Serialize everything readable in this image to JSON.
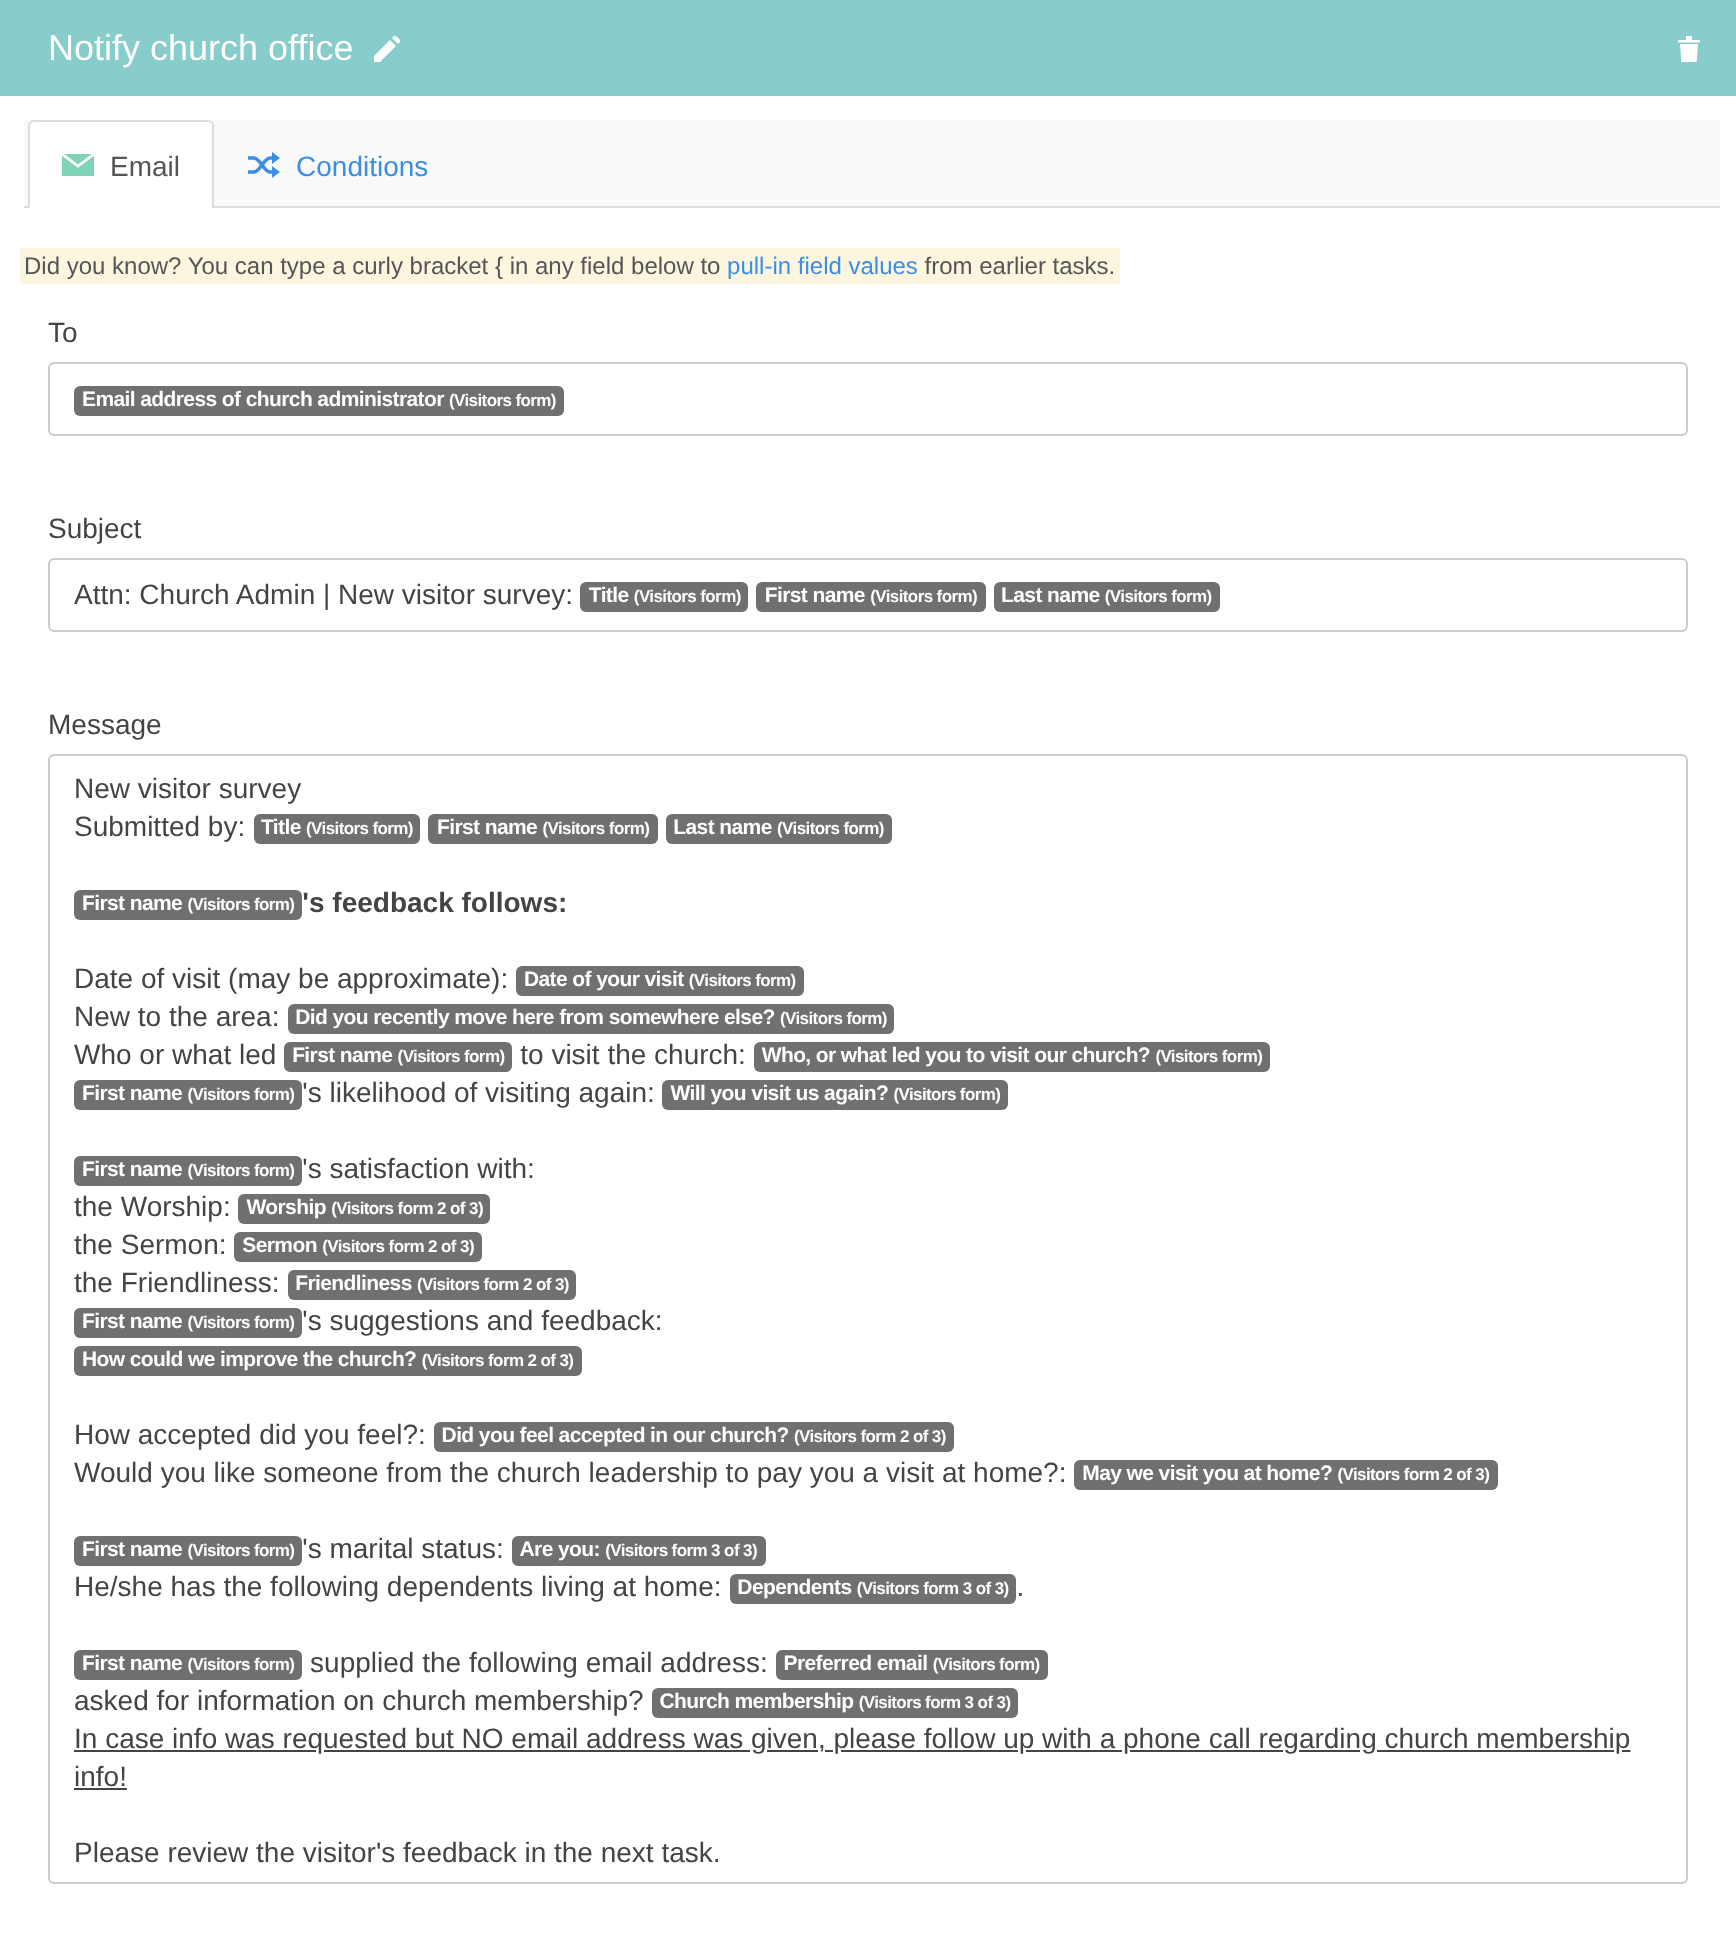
{
  "header": {
    "title": "Notify church office"
  },
  "tabs": [
    {
      "label": "Email",
      "kind": "envelope",
      "selected": true
    },
    {
      "label": "Conditions",
      "kind": "shuffle",
      "selected": false
    }
  ],
  "tip": {
    "before": "Did you know? You can type a curly bracket { in any field below to ",
    "link": "pull-in field values",
    "after": " from earlier tasks."
  },
  "to": {
    "label": "To",
    "tokens": [
      {
        "label": "Email address of church administrator",
        "source": "(Visitors form)"
      }
    ]
  },
  "subject": {
    "label": "Subject",
    "segments": [
      {
        "kind": "text",
        "text": "Attn: Church Admin | New visitor survey: "
      },
      {
        "kind": "token",
        "label": "Title",
        "source": "(Visitors form)"
      },
      {
        "kind": "token",
        "label": "First name",
        "source": "(Visitors form)"
      },
      {
        "kind": "token",
        "label": "Last name",
        "source": "(Visitors form)"
      }
    ]
  },
  "message": {
    "label": "Message",
    "lines": [
      {
        "kind": "line",
        "segments": [
          {
            "kind": "text",
            "text": "New visitor survey"
          }
        ]
      },
      {
        "kind": "line",
        "segments": [
          {
            "kind": "text",
            "text": "Submitted by: "
          },
          {
            "kind": "token",
            "label": "Title",
            "source": "(Visitors form)"
          },
          {
            "kind": "token",
            "label": "First name",
            "source": "(Visitors form)"
          },
          {
            "kind": "token",
            "label": "Last name",
            "source": "(Visitors form)"
          }
        ]
      },
      {
        "kind": "blank"
      },
      {
        "kind": "line",
        "segments": [
          {
            "kind": "token",
            "label": "First name",
            "source": "(Visitors form)"
          },
          {
            "kind": "bold",
            "text": "'s feedback follows:"
          }
        ]
      },
      {
        "kind": "blank"
      },
      {
        "kind": "line",
        "segments": [
          {
            "kind": "text",
            "text": "Date of visit (may be approximate): "
          },
          {
            "kind": "token",
            "label": "Date of your visit",
            "source": "(Visitors form)"
          }
        ]
      },
      {
        "kind": "line",
        "segments": [
          {
            "kind": "text",
            "text": "New to the area: "
          },
          {
            "kind": "token",
            "label": "Did you recently move here from somewhere else?",
            "source": "(Visitors form)"
          }
        ]
      },
      {
        "kind": "line",
        "segments": [
          {
            "kind": "text",
            "text": "Who or what led "
          },
          {
            "kind": "token",
            "label": "First name",
            "source": "(Visitors form)"
          },
          {
            "kind": "text",
            "text": " to visit the church: "
          },
          {
            "kind": "token",
            "label": "Who, or what led you to visit our church?",
            "source": "(Visitors form)"
          }
        ]
      },
      {
        "kind": "line",
        "segments": [
          {
            "kind": "token",
            "label": "First name",
            "source": "(Visitors form)"
          },
          {
            "kind": "text",
            "text": "'s likelihood of visiting again: "
          },
          {
            "kind": "token",
            "label": "Will you visit us again?",
            "source": "(Visitors form)"
          }
        ]
      },
      {
        "kind": "blank"
      },
      {
        "kind": "line",
        "segments": [
          {
            "kind": "token",
            "label": "First name",
            "source": "(Visitors form)"
          },
          {
            "kind": "text",
            "text": "'s satisfaction with:"
          }
        ]
      },
      {
        "kind": "line",
        "segments": [
          {
            "kind": "text",
            "text": "the Worship: "
          },
          {
            "kind": "token",
            "label": "Worship",
            "source": "(Visitors form 2 of 3)"
          }
        ]
      },
      {
        "kind": "line",
        "segments": [
          {
            "kind": "text",
            "text": "the Sermon: "
          },
          {
            "kind": "token",
            "label": "Sermon",
            "source": "(Visitors form 2 of 3)"
          }
        ]
      },
      {
        "kind": "line",
        "segments": [
          {
            "kind": "text",
            "text": "the Friendliness: "
          },
          {
            "kind": "token",
            "label": "Friendliness",
            "source": "(Visitors form 2 of 3)"
          }
        ]
      },
      {
        "kind": "line",
        "segments": [
          {
            "kind": "token",
            "label": "First name",
            "source": "(Visitors form)"
          },
          {
            "kind": "text",
            "text": "'s suggestions and feedback:"
          }
        ]
      },
      {
        "kind": "line",
        "segments": [
          {
            "kind": "token",
            "label": "How could we improve the church?",
            "source": "(Visitors form 2 of 3)"
          }
        ]
      },
      {
        "kind": "blank"
      },
      {
        "kind": "line",
        "segments": [
          {
            "kind": "text",
            "text": "How accepted did you feel?: "
          },
          {
            "kind": "token",
            "label": "Did you feel accepted in our church?",
            "source": "(Visitors form 2 of 3)"
          }
        ]
      },
      {
        "kind": "line",
        "segments": [
          {
            "kind": "text",
            "text": "Would you like someone from the church leadership to pay you a visit at home?: "
          },
          {
            "kind": "token",
            "label": "May we visit you at home?",
            "source": "(Visitors form 2 of 3)"
          }
        ]
      },
      {
        "kind": "blank"
      },
      {
        "kind": "line",
        "segments": [
          {
            "kind": "token",
            "label": "First name",
            "source": "(Visitors form)"
          },
          {
            "kind": "text",
            "text": "'s marital status: "
          },
          {
            "kind": "token",
            "label": "Are you:",
            "source": "(Visitors form 3 of 3)"
          }
        ]
      },
      {
        "kind": "line",
        "segments": [
          {
            "kind": "text",
            "text": "He/she has the following dependents living at home: "
          },
          {
            "kind": "token",
            "label": "Dependents",
            "source": "(Visitors form 3 of 3)"
          },
          {
            "kind": "text",
            "text": "."
          }
        ]
      },
      {
        "kind": "blank"
      },
      {
        "kind": "line",
        "segments": [
          {
            "kind": "token",
            "label": "First name",
            "source": "(Visitors form)"
          },
          {
            "kind": "text",
            "text": " supplied the following email address: "
          },
          {
            "kind": "token",
            "label": "Preferred email",
            "source": "(Visitors form)"
          }
        ]
      },
      {
        "kind": "line",
        "segments": [
          {
            "kind": "text",
            "text": "asked for information on church membership? "
          },
          {
            "kind": "token",
            "label": "Church membership",
            "source": "(Visitors form 3 of 3)"
          }
        ]
      },
      {
        "kind": "line",
        "segments": [
          {
            "kind": "underline",
            "text": "In case info was requested but NO email address was given, please follow up with a phone call regarding church membership info!"
          }
        ]
      },
      {
        "kind": "blank"
      },
      {
        "kind": "line",
        "segments": [
          {
            "kind": "text",
            "text": "Please review the visitor's feedback in the next task."
          }
        ]
      }
    ]
  }
}
